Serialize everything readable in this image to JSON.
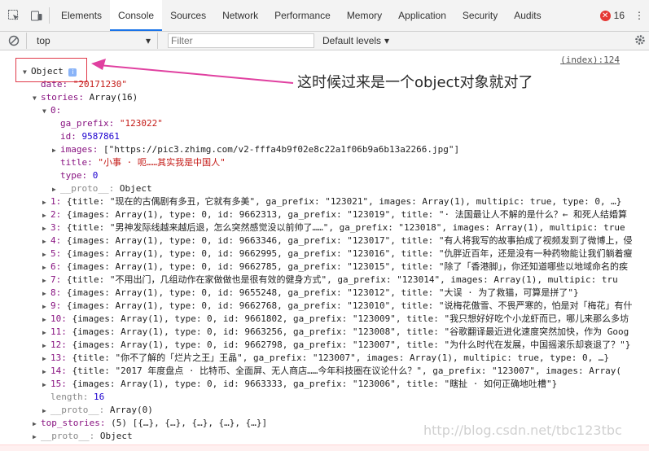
{
  "toolbar": {
    "tabs": [
      "Elements",
      "Console",
      "Sources",
      "Network",
      "Performance",
      "Memory",
      "Application",
      "Security",
      "Audits"
    ],
    "active_tab": "Console",
    "error_count": "16",
    "more": "⋮"
  },
  "filterbar": {
    "context": "top",
    "filter_placeholder": "Filter",
    "levels": "Default levels"
  },
  "console": {
    "source_link": "(index):124",
    "object_label": "Object",
    "annotation": "这时候过来是一个object对象就对了",
    "watermark": "http://blog.csdn.net/tbc123tbc",
    "lines": [
      {
        "d": 0,
        "t": "date: \"20171230\""
      },
      {
        "d": 0,
        "t": "▼ stories: Array(16)"
      },
      {
        "d": 1,
        "t": "▼ 0:"
      },
      {
        "d": 2,
        "t": "ga_prefix: \"123022\""
      },
      {
        "d": 2,
        "t": "id: 9587861"
      },
      {
        "d": 2,
        "t": "▶ images: [\"https://pic3.zhimg.com/v2-fffa4b9f02e8c22a1f06b9a6b13a2266.jpg\"]"
      },
      {
        "d": 2,
        "t": "title: \"小事 · 呃……其实我是中国人\""
      },
      {
        "d": 2,
        "t": "type: 0"
      },
      {
        "d": 2,
        "t": "▶ __proto__: Object"
      },
      {
        "d": 1,
        "t": "▶ 1: {title: \"现在的古偶剧有多丑，它就有多美\", ga_prefix: \"123021\", images: Array(1), multipic: true, type: 0, …}"
      },
      {
        "d": 1,
        "t": "▶ 2: {images: Array(1), type: 0, id: 9662313, ga_prefix: \"123019\", title: \"· 法国最让人不解的是什么？← 和死人结婚算"
      },
      {
        "d": 1,
        "t": "▶ 3: {title: \"男神发际线越来越后退，怎么突然感觉没以前帅了……\", ga_prefix: \"123018\", images: Array(1), multipic: true"
      },
      {
        "d": 1,
        "t": "▶ 4: {images: Array(1), type: 0, id: 9663346, ga_prefix: \"123017\", title: \"有人将我写的故事拍成了视频发到了微博上，侵"
      },
      {
        "d": 1,
        "t": "▶ 5: {images: Array(1), type: 0, id: 9662995, ga_prefix: \"123016\", title: \"仇胖近百年，还是没有一种药物能让我们躺着瘦"
      },
      {
        "d": 1,
        "t": "▶ 6: {images: Array(1), type: 0, id: 9662785, ga_prefix: \"123015\", title: \"除了「香港脚」，你还知道哪些以地域命名的疾"
      },
      {
        "d": 1,
        "t": "▶ 7: {title: \"不用出门，几组动作在家做做也是很有效的健身方式\", ga_prefix: \"123014\", images: Array(1), multipic: tru"
      },
      {
        "d": 1,
        "t": "▶ 8: {images: Array(1), type: 0, id: 9655248, ga_prefix: \"123012\", title: \"大误 · 为了救猫，可算是拼了\"}"
      },
      {
        "d": 1,
        "t": "▶ 9: {images: Array(1), type: 0, id: 9662768, ga_prefix: \"123010\", title: \"说梅花傲雪、不畏严寒的，怕是对「梅花」有什"
      },
      {
        "d": 1,
        "t": "▶ 10: {images: Array(1), type: 0, id: 9661802, ga_prefix: \"123009\", title: \"我只想好好吃个小龙虾而已，哪儿来那么多坊"
      },
      {
        "d": 1,
        "t": "▶ 11: {images: Array(1), type: 0, id: 9663256, ga_prefix: \"123008\", title: \"谷歌翻译最近进化速度突然加快，作为 Goog"
      },
      {
        "d": 1,
        "t": "▶ 12: {images: Array(1), type: 0, id: 9662798, ga_prefix: \"123007\", title: \"为什么时代在发展，中国摇滚乐却衰退了？\"}"
      },
      {
        "d": 1,
        "t": "▶ 13: {title: \"你不了解的「烂片之王」王晶\", ga_prefix: \"123007\", images: Array(1), multipic: true, type: 0, …}"
      },
      {
        "d": 1,
        "t": "▶ 14: {title: \"2017 年度盘点 · 比特币、全面屏、无人商店……今年科技圈在议论什么？\", ga_prefix: \"123007\", images: Array("
      },
      {
        "d": 1,
        "t": "▶ 15: {images: Array(1), type: 0, id: 9663333, ga_prefix: \"123006\", title: \"瞎扯 · 如何正确地吐槽\"}"
      },
      {
        "d": 1,
        "t": "length: 16"
      },
      {
        "d": 1,
        "t": "▶ __proto__: Array(0)"
      },
      {
        "d": 0,
        "t": "▶ top_stories: (5) [{…}, {…}, {…}, {…}, {…}]"
      },
      {
        "d": 0,
        "t": "▶ __proto__: Object"
      }
    ]
  }
}
